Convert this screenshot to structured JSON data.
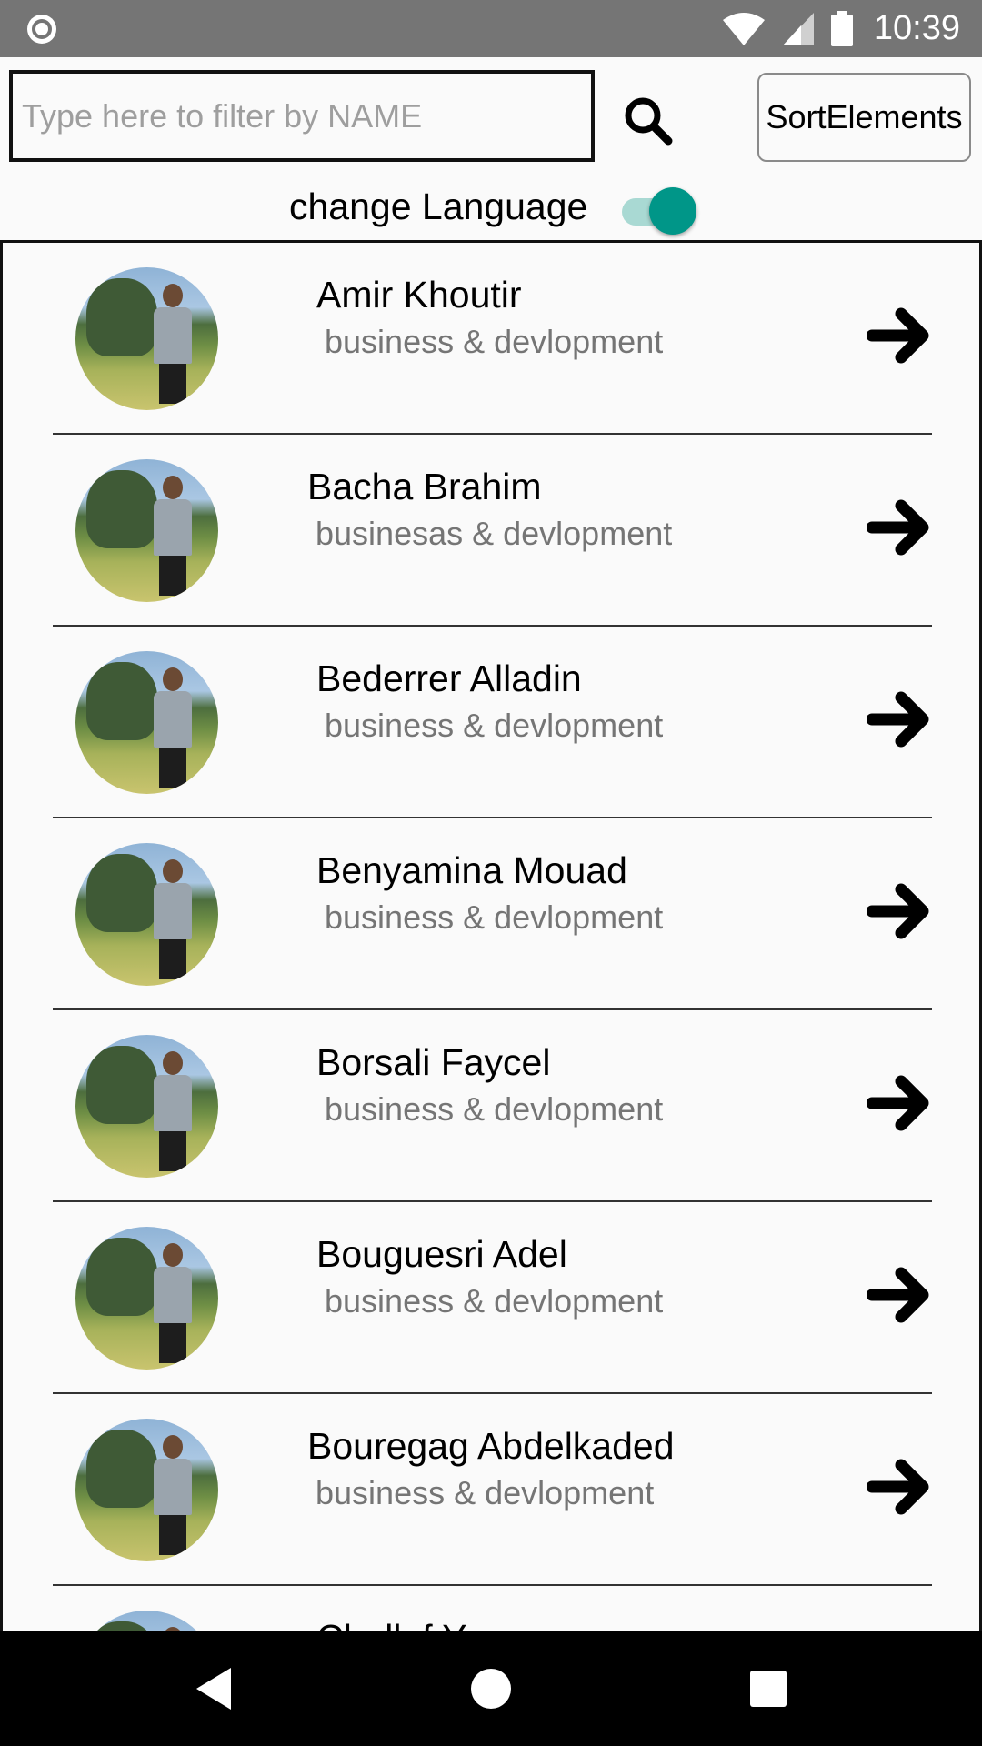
{
  "status_bar": {
    "time": "10:39",
    "icons": [
      "record-icon",
      "wifi-icon",
      "signal-icon",
      "battery-icon"
    ]
  },
  "filter": {
    "placeholder": "Type here to filter by NAME",
    "value": ""
  },
  "search_icon": "search-icon",
  "sort_button_label": "SortElements",
  "language": {
    "label": "change Language",
    "toggle_on": true,
    "accent_color": "#009688"
  },
  "list_items": [
    {
      "name": "Amir Khoutir",
      "subtitle": "business & devlopment"
    },
    {
      "name": "Bacha Brahim",
      "subtitle": "businesas & devlopment"
    },
    {
      "name": "Bederrer Alladin",
      "subtitle": "business & devlopment"
    },
    {
      "name": "Benyamina Mouad",
      "subtitle": "business & devlopment"
    },
    {
      "name": "Borsali Faycel",
      "subtitle": "business & devlopment"
    },
    {
      "name": "Bouguesri Adel",
      "subtitle": "business & devlopment"
    },
    {
      "name": "Bouregag Abdelkaded",
      "subtitle": "business & devlopment"
    },
    {
      "name": "Chellaf Y",
      "subtitle": ""
    }
  ],
  "nav_bar": {
    "icons": [
      "back-icon",
      "home-icon",
      "recents-icon"
    ]
  }
}
